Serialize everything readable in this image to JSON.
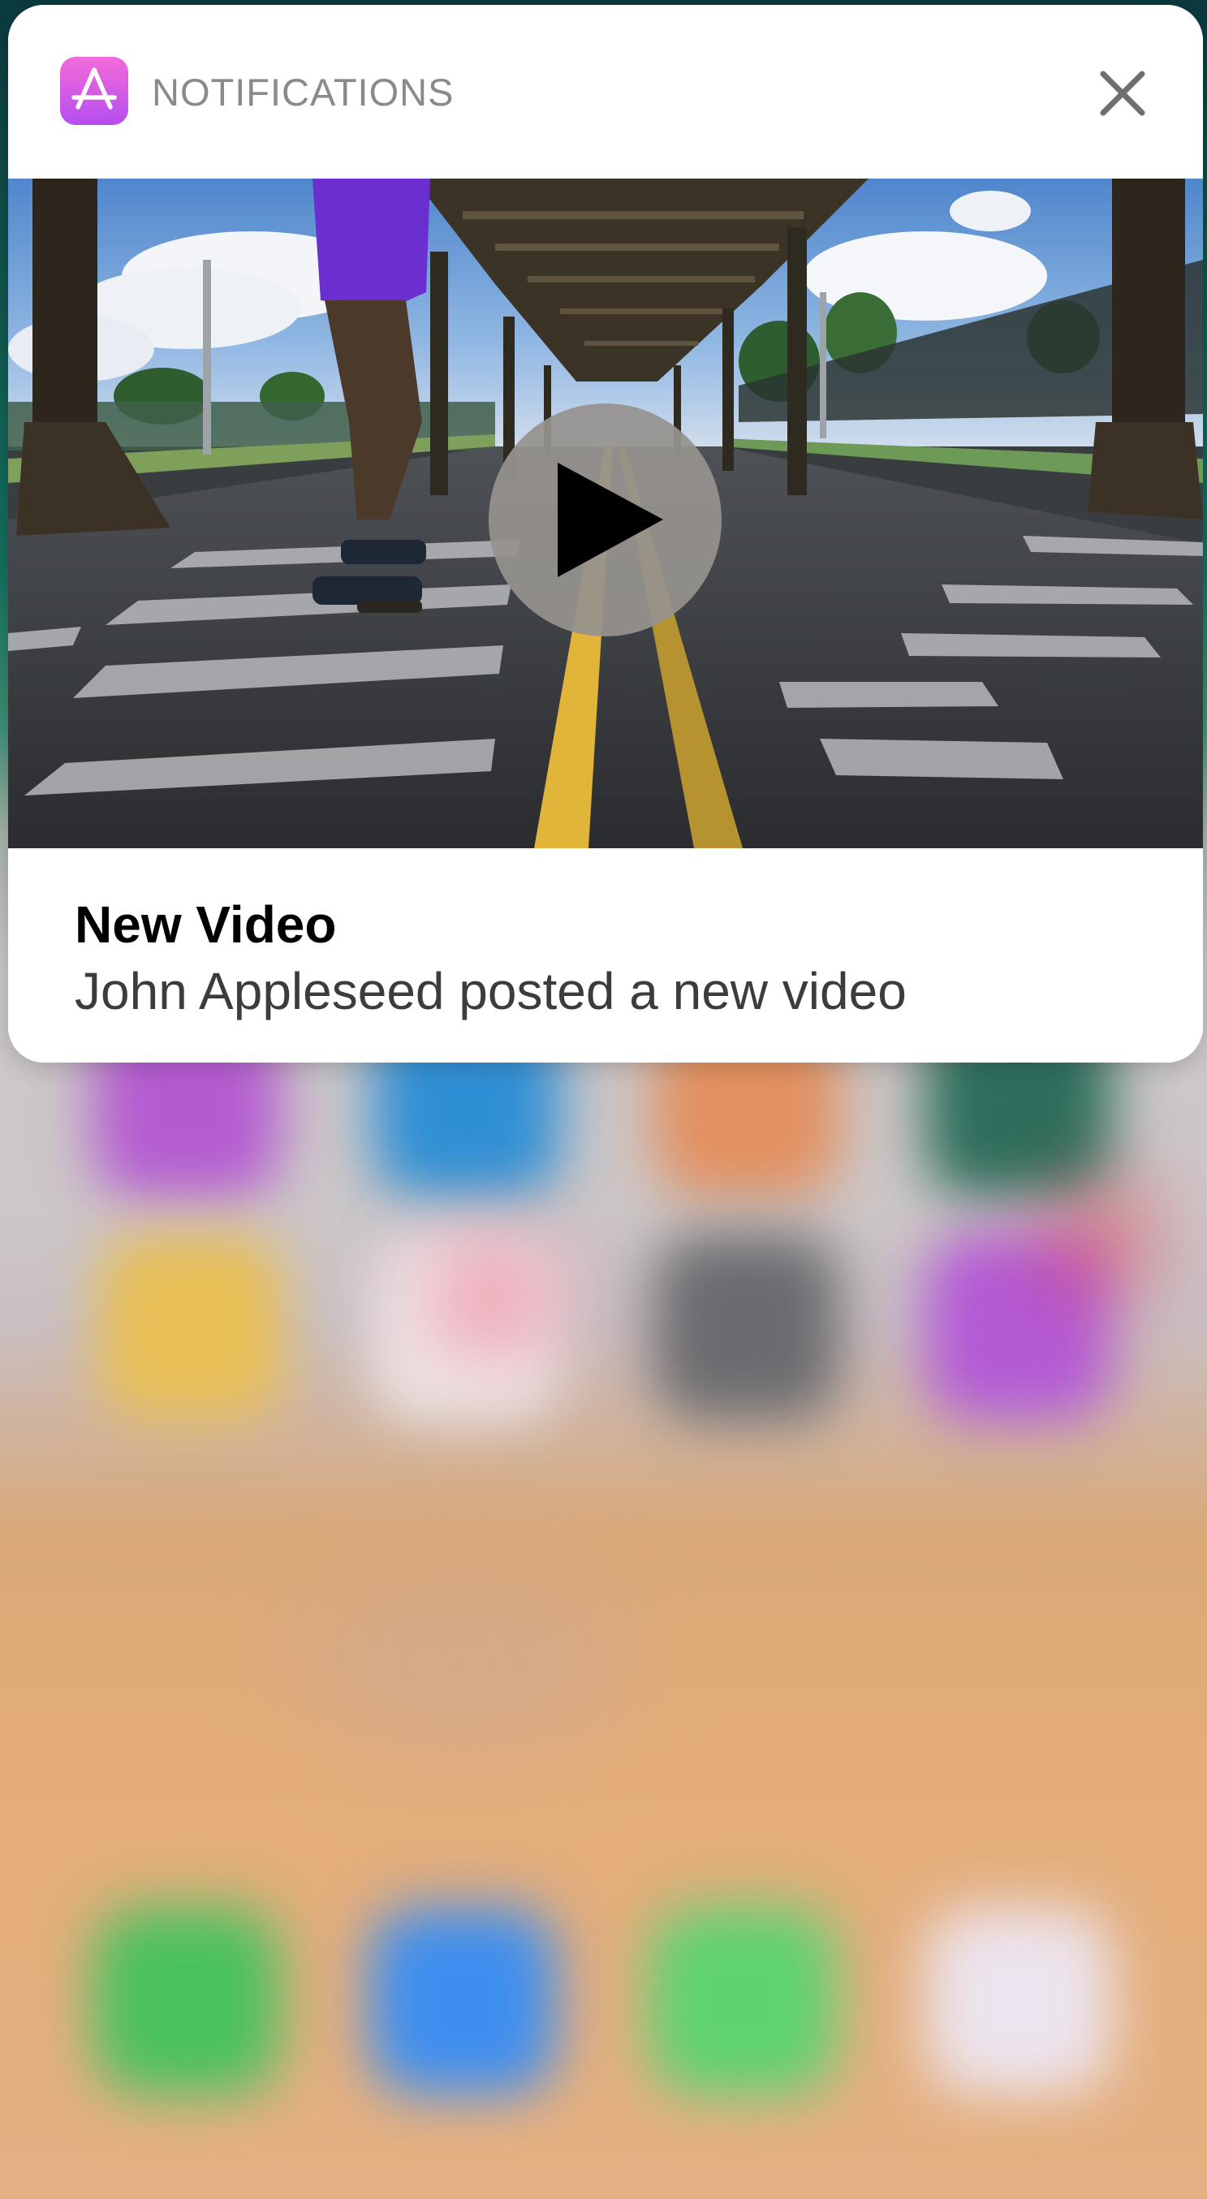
{
  "notification": {
    "app_name": "NOTIFICATIONS",
    "app_icon": "app-store-icon",
    "close_icon": "close-icon",
    "play_icon": "play-icon",
    "title": "New Video",
    "body": "John Appleseed posted a new video"
  },
  "colors": {
    "app_icon_gradient": [
      "#f46bd9",
      "#b44ef0"
    ],
    "header_text": "#8a8a8e",
    "title_text": "#000000",
    "body_text": "#3c3c3e"
  }
}
